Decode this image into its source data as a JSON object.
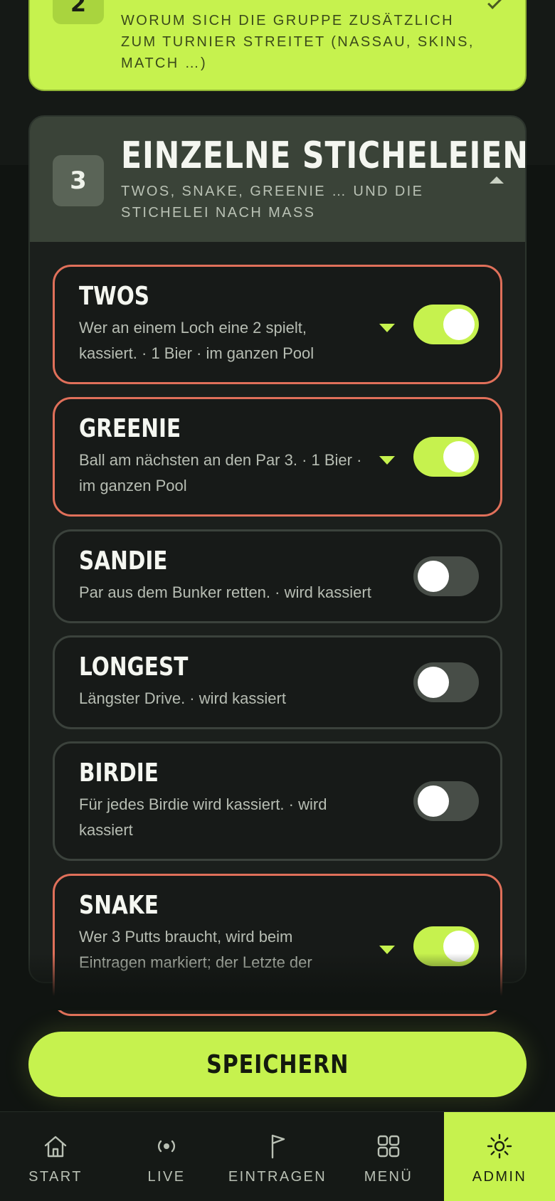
{
  "section2": {
    "number": "2",
    "subtitle": "Worum sich die Gruppe zusätzlich zum Turnier streitet (Nassau, Skins, Match …)"
  },
  "section3": {
    "number": "3",
    "title": "EINZELNE STICHELEIEN",
    "subtitle": "Twos, Snake, Greenie … und die Stichelei nach Mass",
    "items": [
      {
        "title": "TWOS",
        "description": "Wer an einem Loch eine 2 spielt, kassiert. · 1 Bier · im ganzen Pool",
        "enabled": true
      },
      {
        "title": "GREENIE",
        "description": "Ball am nächsten an den Par 3. · 1 Bier · im ganzen Pool",
        "enabled": true
      },
      {
        "title": "SANDIE",
        "description": "Par aus dem Bunker retten. · wird kassiert",
        "enabled": false
      },
      {
        "title": "LONGEST",
        "description": "Längster Drive. · wird kassiert",
        "enabled": false
      },
      {
        "title": "BIRDIE",
        "description": "Für jedes Birdie wird kassiert. · wird kassiert",
        "enabled": false
      },
      {
        "title": "SNAKE",
        "description": "Wer 3 Putts braucht, wird beim Eintragen markiert; der Letzte der",
        "enabled": true
      }
    ]
  },
  "save_label": "SPEICHERN",
  "nav": [
    {
      "label": "START",
      "icon": "home-icon"
    },
    {
      "label": "LIVE",
      "icon": "live-icon"
    },
    {
      "label": "EINTRAGEN",
      "icon": "flag-icon"
    },
    {
      "label": "MENÜ",
      "icon": "grid-icon"
    },
    {
      "label": "ADMIN",
      "icon": "sun-icon",
      "active": true
    }
  ],
  "colors": {
    "accent": "#c6f24e",
    "active_border": "#e0705a",
    "background": "#101411"
  }
}
